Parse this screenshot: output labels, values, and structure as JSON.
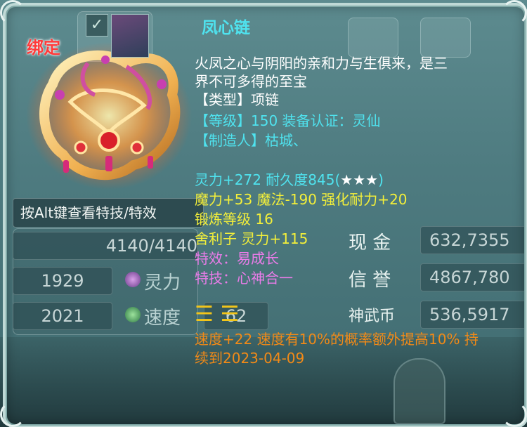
{
  "item": {
    "bound_label": "绑定",
    "name": "凤心链",
    "description": [
      "火凤之心与阴阳的亲和力与生俱来，是三",
      "界不可多得的至宝"
    ],
    "type_line": "【类型】项链",
    "level_line": "【等级】150 装备认证：灵仙",
    "maker_line": "【制造人】枯城、",
    "stat_line_1": "灵力+272 耐久度845(",
    "stars": "★★★",
    "stat_line_1_end": ")",
    "stat_line_2": "魔力+53 魔法-190 强化耐力+20",
    "stat_line_3": "锻炼等级 16",
    "stat_line_4": "舍利子 灵力+115",
    "special_effect": "特效：易成长",
    "special_skill": "特技：心神合一",
    "trigram_1": "☰",
    "trigram_2": "☰",
    "bonus_line_1": "速度+22 速度有10%的概率额外提高10% 持",
    "bonus_line_2": "续到2023-04-09"
  },
  "alt_hint": "按Alt键查看特技/特效",
  "background": {
    "hp_value": "4140/4140",
    "value_1929": "1929",
    "value_2021": "2021",
    "label_lingli": "灵力",
    "label_sudu": "速度",
    "label_xianjin": "现 金",
    "label_xinyu": "信 誉",
    "label_shenwubi": "神武币",
    "cash": "632,7355",
    "credit": "4867,780",
    "shenwubi": "536,5917",
    "field_62": "62"
  },
  "colors": {
    "title": "#4fe3ef",
    "stat_yellow": "#f3ef3a",
    "effect_purple": "#ea7ce9",
    "bonus_orange": "#f28a17",
    "bound_red": "#ff3a3a"
  }
}
